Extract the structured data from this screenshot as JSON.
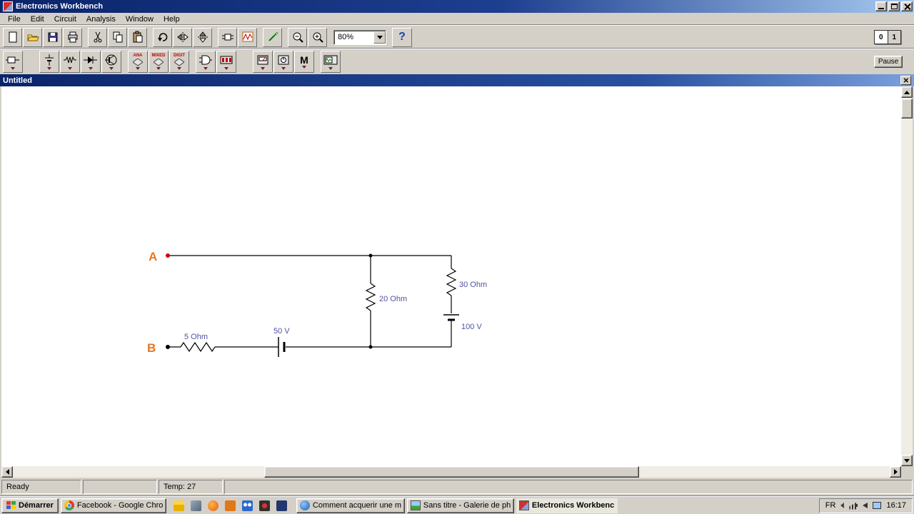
{
  "window": {
    "title": "Electronics Workbench"
  },
  "menu": {
    "items": [
      "File",
      "Edit",
      "Circuit",
      "Analysis",
      "Window",
      "Help"
    ]
  },
  "toolbar": {
    "zoom_level": "80%",
    "help_label": "?",
    "power_zero": "0",
    "power_one": "1"
  },
  "parts": {
    "ana": "ANA",
    "mixed": "MIXED",
    "digit": "DIGIT",
    "misc": "M",
    "pause": "Pause"
  },
  "doc": {
    "title": "Untitled"
  },
  "circuit": {
    "labels": {
      "a": "A",
      "b": "B",
      "r1": "5 Ohm",
      "r2": "20 Ohm",
      "r3": "30 Ohm",
      "v1": "50 V",
      "v2": "100 V"
    },
    "components": [
      {
        "id": "R1",
        "type": "resistor",
        "value": "5 Ohm"
      },
      {
        "id": "V1",
        "type": "battery",
        "value": "50 V"
      },
      {
        "id": "R2",
        "type": "resistor",
        "value": "20 Ohm"
      },
      {
        "id": "R3",
        "type": "resistor",
        "value": "30 Ohm"
      },
      {
        "id": "V2",
        "type": "battery",
        "value": "100 V"
      }
    ]
  },
  "status": {
    "ready": "Ready",
    "temp": "Temp:  27"
  },
  "taskbar": {
    "start_label": "Démarrer",
    "tasks": [
      {
        "label": "Facebook - Google Chrome"
      },
      {
        "label": "Comment acquerir une m..."
      },
      {
        "label": "Sans titre - Galerie de ph..."
      },
      {
        "label": "Electronics Workbenc..."
      }
    ],
    "tray_lang": "FR",
    "tray_time": "16:17"
  },
  "colors": {
    "titlebar": "#0a246a",
    "face": "#d4d0c8",
    "label_blue": "#5151a3",
    "node_orange": "#e8761f"
  }
}
